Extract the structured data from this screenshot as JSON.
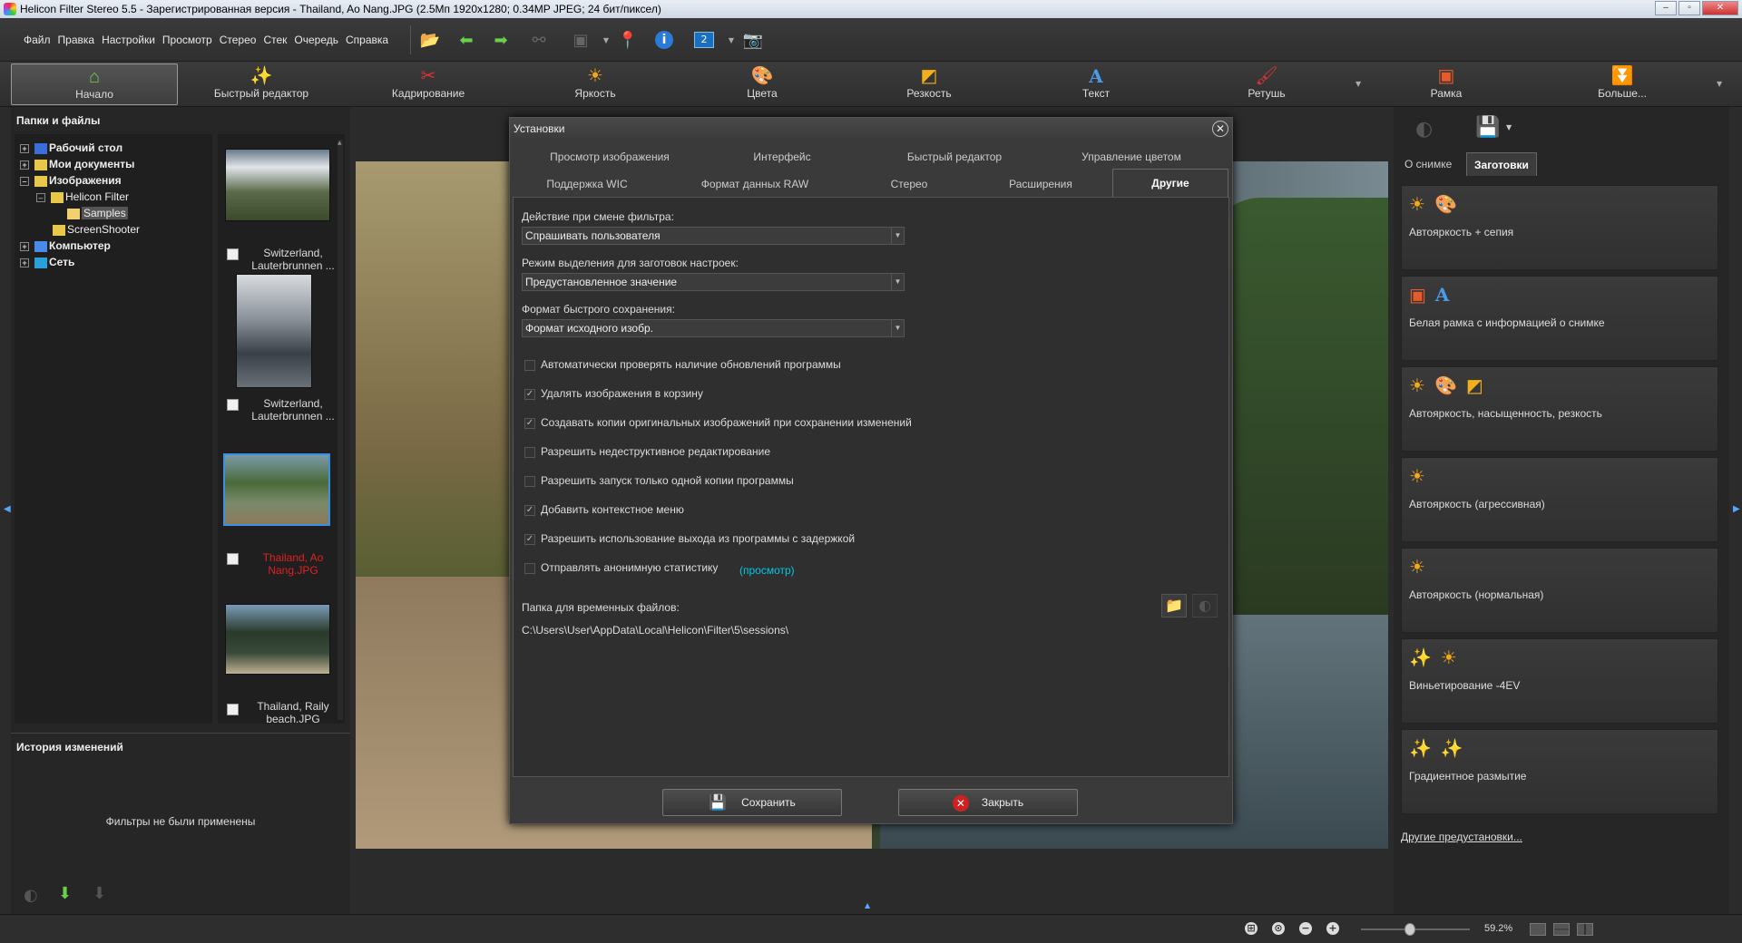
{
  "window": {
    "title": "Helicon Filter Stereo 5.5 - Зарегистрированная версия - Thailand, Ao Nang.JPG (2.5Мп 1920x1280; 0.34MP JPEG; 24 бит/пиксел)",
    "minimize": "–",
    "maximize": "▫",
    "close": "✕"
  },
  "menu": [
    "Файл",
    "Правка",
    "Настройки",
    "Просмотр",
    "Стерео",
    "Стек",
    "Очередь",
    "Справка"
  ],
  "ribbon": {
    "tabs": [
      {
        "label": "Начало",
        "icon": "home-icon"
      },
      {
        "label": "Быстрый редактор",
        "icon": "magic-wand-icon"
      },
      {
        "label": "Кадрирование",
        "icon": "scissors-icon"
      },
      {
        "label": "Яркость",
        "icon": "sun-icon"
      },
      {
        "label": "Цвета",
        "icon": "palette-icon"
      },
      {
        "label": "Резкость",
        "icon": "sharpen-icon"
      },
      {
        "label": "Текст",
        "icon": "text-a-icon"
      },
      {
        "label": "Ретушь",
        "icon": "brush-icon"
      },
      {
        "label": "Рамка",
        "icon": "frame-icon"
      },
      {
        "label": "Больше...",
        "icon": "chevrons-down-icon"
      }
    ]
  },
  "left": {
    "folders_title": "Папки и файлы",
    "tree": [
      {
        "label": "Рабочий стол",
        "bold": true
      },
      {
        "label": "Мои документы",
        "bold": true
      },
      {
        "label": "Изображения",
        "bold": true
      },
      {
        "label": "Helicon Filter",
        "bold": false
      },
      {
        "label": "Samples",
        "bold": false
      },
      {
        "label": "ScreenShooter",
        "bold": false
      },
      {
        "label": "Компьютер",
        "bold": true
      },
      {
        "label": "Сеть",
        "bold": true
      }
    ],
    "thumbs": [
      {
        "caption": "Switzerland, Lauterbrunnen ..."
      },
      {
        "caption": "Switzerland, Lauterbrunnen ..."
      },
      {
        "caption": "Thailand, Ao Nang.JPG"
      },
      {
        "caption": "Thailand, Raily beach.JPG"
      }
    ],
    "history_title": "История изменений",
    "history_empty": "Фильтры не были применены"
  },
  "dialog": {
    "title": "Установки",
    "tabs_row1": [
      "Просмотр изображения",
      "Интерфейс",
      "Быстрый редактор",
      "Управление цветом"
    ],
    "tabs_row2": [
      "Поддержка WIC",
      "Формат данных RAW",
      "Стерео",
      "Расширения",
      "Другие"
    ],
    "active_tab": "Другие",
    "filter_change_label": "Действие при смене фильтра:",
    "filter_change_value": "Спрашивать пользователя",
    "preset_mode_label": "Режим выделения для заготовок настроек:",
    "preset_mode_value": "Предустановленное значение",
    "quicksave_label": "Формат быстрого сохранения:",
    "quicksave_value": "Формат исходного изобр.",
    "checkboxes": [
      {
        "label": "Автоматически проверять наличие обновлений программы",
        "checked": false
      },
      {
        "label": "Удалять изображения в корзину",
        "checked": true
      },
      {
        "label": "Создавать копии оригинальных изображений при сохранении изменений",
        "checked": true
      },
      {
        "label": "Разрешить недеструктивное редактирование",
        "checked": false
      },
      {
        "label": "Разрешить запуск только одной копии программы",
        "checked": false
      },
      {
        "label": "Добавить контекстное меню",
        "checked": true
      },
      {
        "label": "Разрешить использование выхода из программы с задержкой",
        "checked": true
      },
      {
        "label": "Отправлять анонимную статистику",
        "checked": false
      }
    ],
    "view_link": "(просмотр)",
    "temp_folder_label": "Папка для временных файлов:",
    "temp_folder_value": "C:\\Users\\User\\AppData\\Local\\Helicon\\Filter\\5\\sessions\\",
    "save_label": "Сохранить",
    "close_label": "Закрыть"
  },
  "right": {
    "tab_about": "О снимке",
    "tab_presets": "Заготовки",
    "presets": [
      {
        "label": "Автояркость + сепия",
        "icons": [
          "sun-icon",
          "palette-icon"
        ]
      },
      {
        "label": "Белая рамка с информацией о снимке",
        "icons": [
          "frame-icon",
          "text-a-icon"
        ]
      },
      {
        "label": "Автояркость, насыщенность, резкость",
        "icons": [
          "sun-icon",
          "palette-icon",
          "sharpen-icon"
        ]
      },
      {
        "label": "Автояркость (агрессивная)",
        "icons": [
          "sun-icon"
        ]
      },
      {
        "label": "Автояркость (нормальная)",
        "icons": [
          "sun-icon"
        ]
      },
      {
        "label": "Виньетирование -4EV",
        "icons": [
          "magic-wand-icon",
          "sun-icon"
        ]
      },
      {
        "label": "Градиентное размытие",
        "icons": [
          "magic-wand-icon",
          "magic-wand-icon"
        ]
      }
    ],
    "more_presets": "Другие предустановки..."
  },
  "status": {
    "zoom": "59.2%",
    "zoom_fraction": 0.45
  },
  "colors": {
    "accent_link": "#00c8e8",
    "selected_red": "#e02020",
    "thumb_selection": "#3a8fe0"
  }
}
